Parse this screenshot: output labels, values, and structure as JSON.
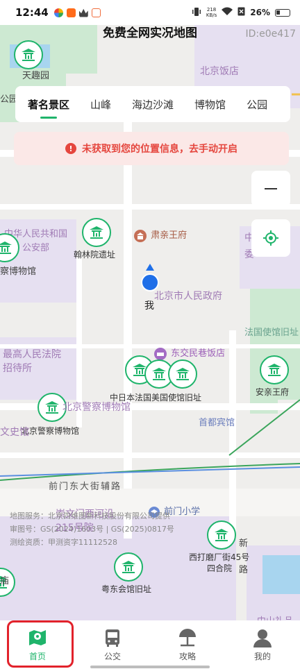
{
  "status_bar": {
    "time": "12:44",
    "network_speed": "218",
    "network_unit": "KB/s",
    "battery": "26%"
  },
  "header": {
    "title": "免费全网实况地图",
    "page_id": "ID:e0e417"
  },
  "tabs": [
    {
      "label": "著名景区",
      "active": true
    },
    {
      "label": "山峰",
      "active": false
    },
    {
      "label": "海边沙滩",
      "active": false
    },
    {
      "label": "博物馆",
      "active": false
    },
    {
      "label": "公园",
      "active": false
    }
  ],
  "alert": {
    "icon": "exclamation-icon",
    "text": "未获取到您的位置信息，去手动开启"
  },
  "map": {
    "labels": {
      "tianqu": "天趣园",
      "gongyuan": "公园",
      "beijing_hotel": "北京饭店",
      "security_bureau_1": "中华人民共和国",
      "security_bureau_2": "公安部",
      "police_museum_partial": "察博物馆",
      "hanlin_site": "翰林院遗址",
      "suqinwang": "肃亲王府",
      "govt": "北京市人民政府",
      "me": "我",
      "zhong": "中",
      "wei": "委",
      "france_embassy": "法国使馆旧址",
      "supreme_court_1": "最高人民法院",
      "supreme_court_2": "招待所",
      "dongjiao_hotel": "东交民巷饭店",
      "cluster_label": "中日本法国美国使馆旧址",
      "anqingwang": "安亲王府",
      "bj_police_museum": "北京警察博物馆",
      "police_museum_2": "北京警察博物馆",
      "wenshi": "文史馆",
      "shoudu_hotel": "首都宾馆",
      "qianmen_road": "前门东大街辅路",
      "chongwen": "崇文门西河沿",
      "no215": "215号院",
      "qianmen_school": "前门小学",
      "xidamo_1": "西打磨厂街45号",
      "xidamo_2": "四合院",
      "xin": "新",
      "lu": "路",
      "yuedong": "粤东会馆旧址",
      "zhongshan": "中山礼品",
      "yuan": "庙"
    },
    "credits": [
      "地图服务：北京四维图新科技股份有限公司提供",
      "审图号：GS(2024)1603号 | GS(2025)0817号",
      "测绘资质：甲测资字11112528"
    ]
  },
  "bottom_nav": [
    {
      "label": "首页",
      "icon": "map-icon",
      "active": true
    },
    {
      "label": "公交",
      "icon": "bus-icon",
      "active": false
    },
    {
      "label": "攻略",
      "icon": "umbrella-icon",
      "active": false
    },
    {
      "label": "我的",
      "icon": "user-icon",
      "active": false
    }
  ],
  "colors": {
    "accent": "#1fb46b",
    "alert": "#e5463e",
    "highlight_box": "#e2222b"
  }
}
